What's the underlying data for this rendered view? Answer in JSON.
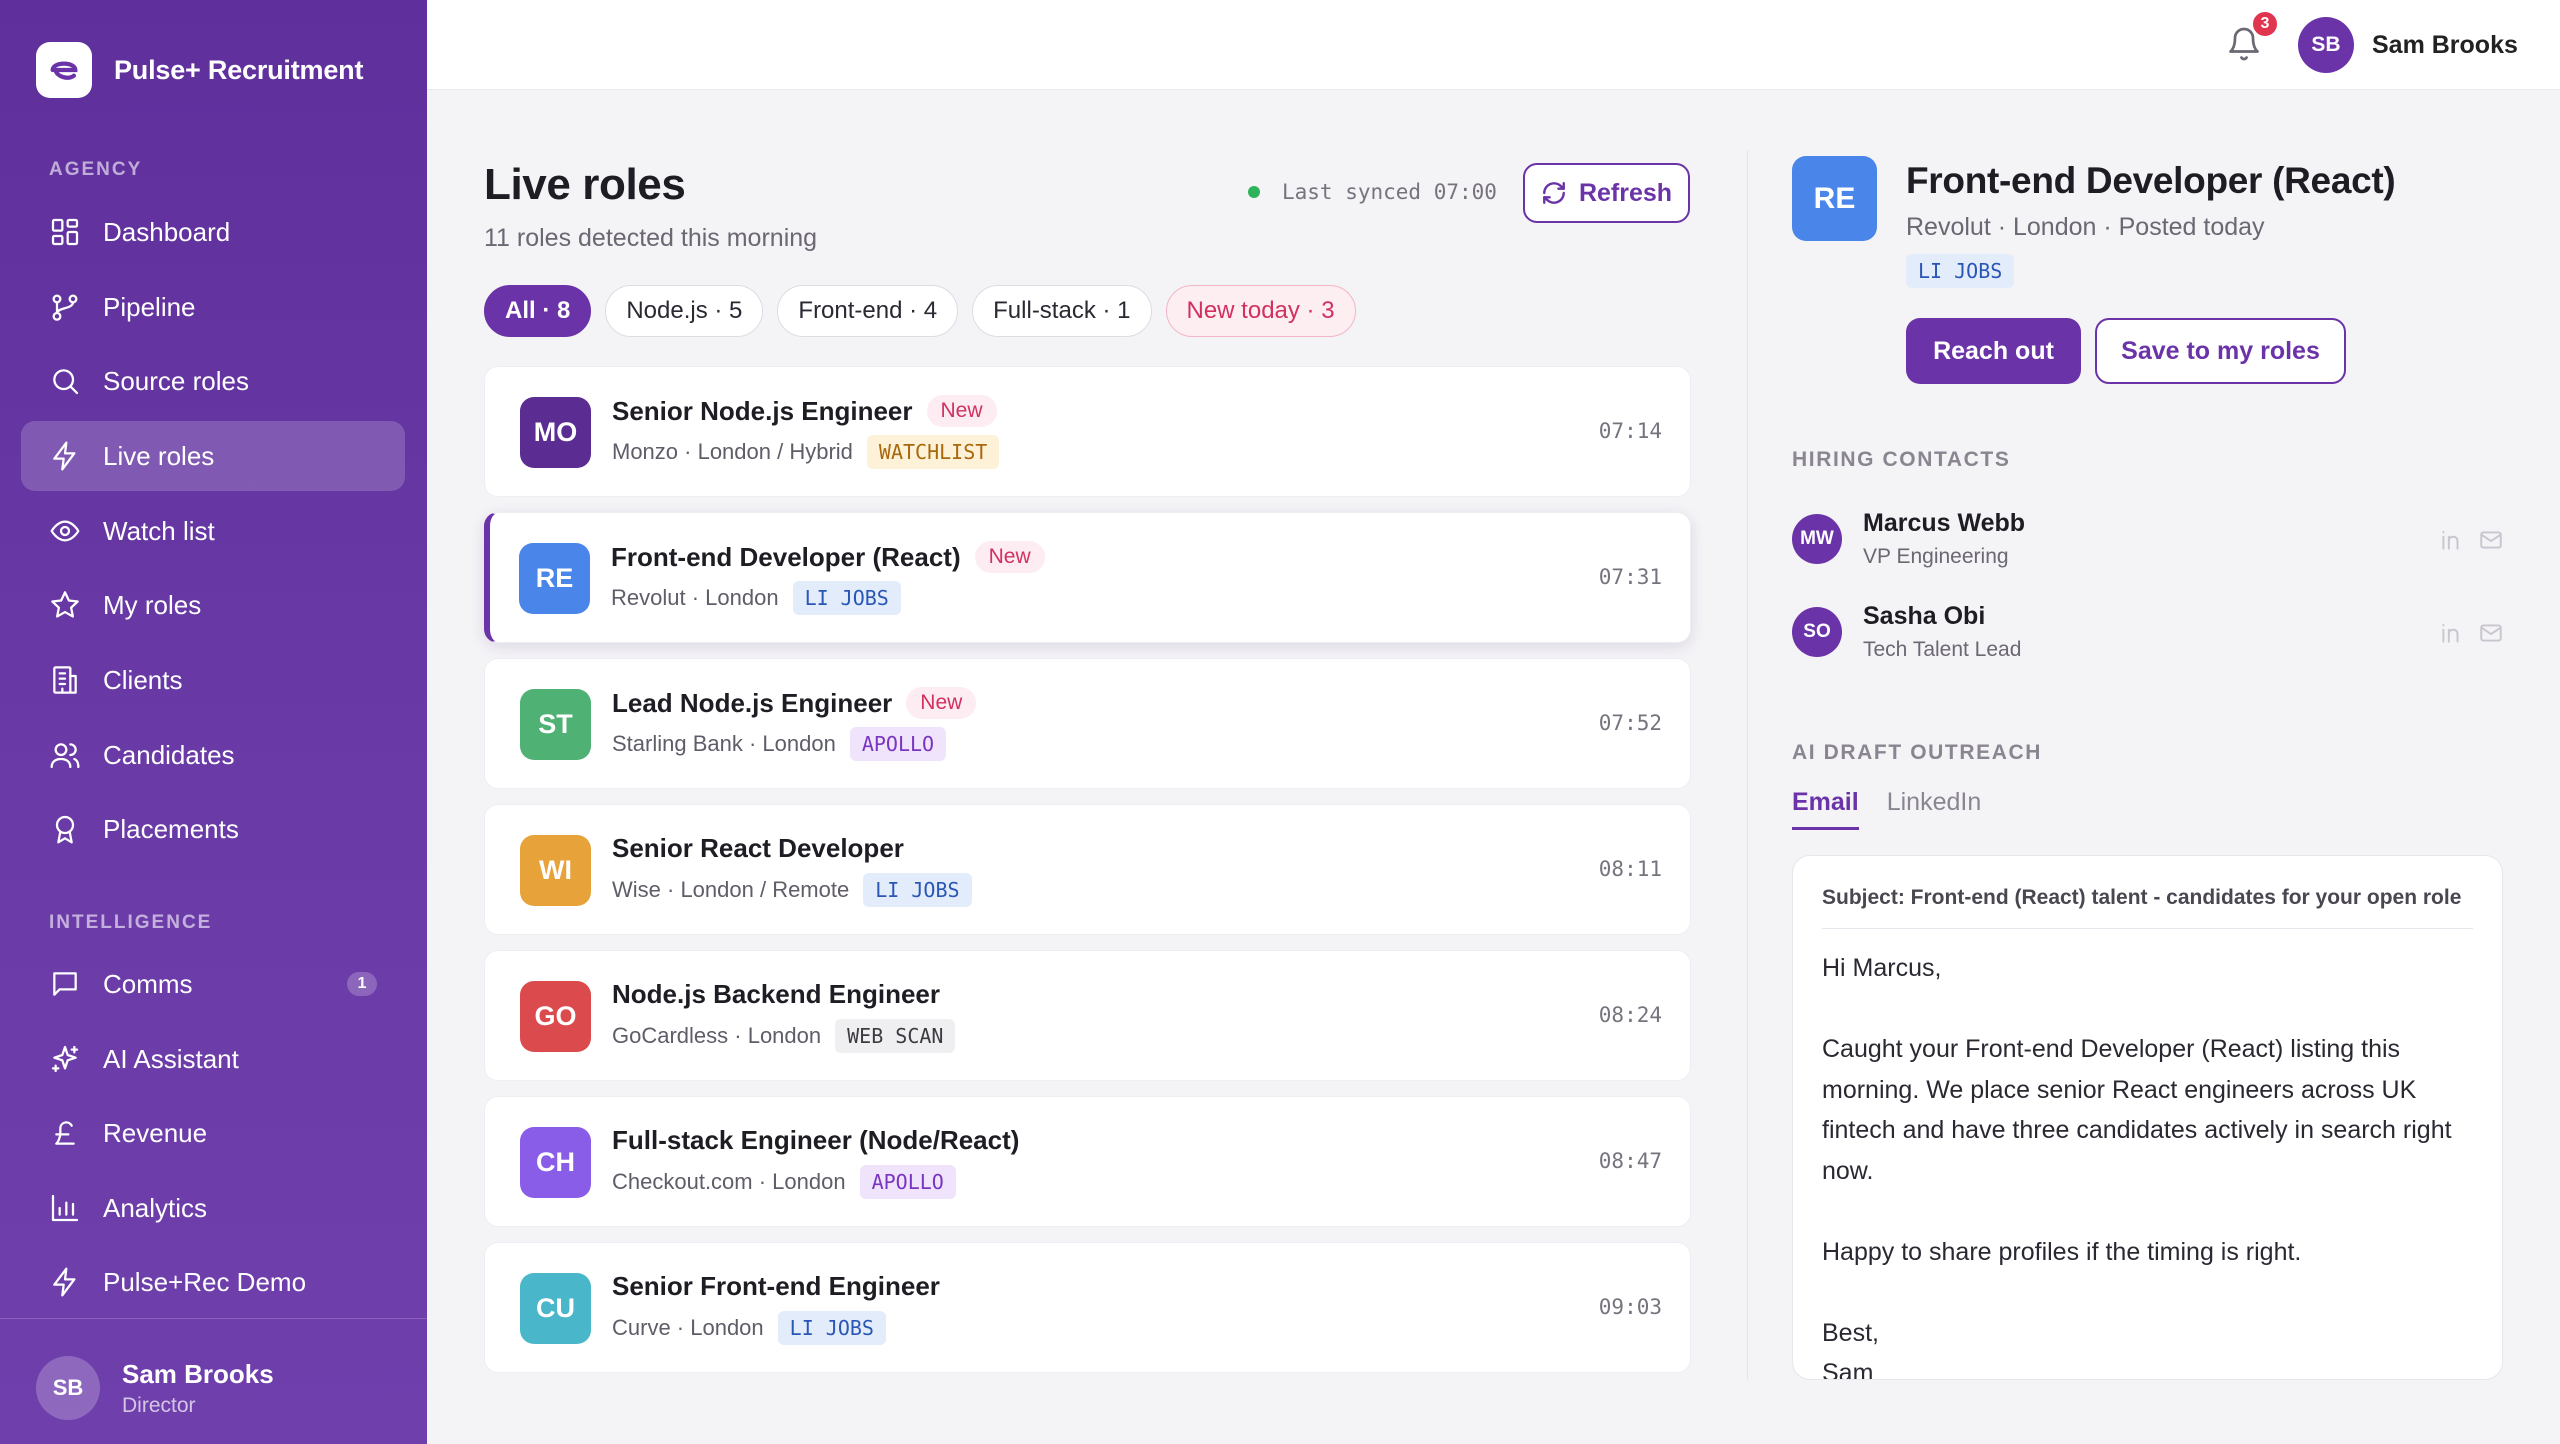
{
  "app": {
    "brand": "Pulse+ Recruitment"
  },
  "sidebar": {
    "sections": {
      "agency": "AGENCY",
      "intelligence": "INTELLIGENCE"
    },
    "items": [
      {
        "label": "Dashboard",
        "icon": "dashboard-icon"
      },
      {
        "label": "Pipeline",
        "icon": "pipeline-icon"
      },
      {
        "label": "Source roles",
        "icon": "search-icon"
      },
      {
        "label": "Live roles",
        "icon": "lightning-icon",
        "active": true
      },
      {
        "label": "Watch list",
        "icon": "eye-icon"
      },
      {
        "label": "My roles",
        "icon": "star-icon"
      },
      {
        "label": "Clients",
        "icon": "building-icon"
      },
      {
        "label": "Candidates",
        "icon": "users-icon"
      },
      {
        "label": "Placements",
        "icon": "award-icon"
      },
      {
        "label": "Comms",
        "icon": "message-icon",
        "badge": "1"
      },
      {
        "label": "AI Assistant",
        "icon": "sparkle-icon"
      },
      {
        "label": "Revenue",
        "icon": "pound-icon"
      },
      {
        "label": "Analytics",
        "icon": "bar-chart-icon"
      },
      {
        "label": "Pulse+Rec Demo",
        "icon": "lightning-icon"
      }
    ],
    "user": {
      "initials": "SB",
      "name": "Sam Brooks",
      "role": "Director"
    }
  },
  "topbar": {
    "notifications": "3",
    "user_initials": "SB",
    "user_name": "Sam Brooks"
  },
  "main": {
    "title": "Live roles",
    "subtitle": "11 roles detected this morning",
    "sync_text": "Last synced 07:00",
    "refresh_label": "Refresh",
    "filters": [
      {
        "label": "All · 8",
        "state": "active"
      },
      {
        "label": "Node.js · 5",
        "state": ""
      },
      {
        "label": "Front-end · 4",
        "state": ""
      },
      {
        "label": "Full-stack · 1",
        "state": ""
      },
      {
        "label": "New today · 3",
        "state": "hot"
      }
    ],
    "roles": [
      {
        "initials": "MO",
        "color": "#5b2d93",
        "title": "Senior Node.js Engineer",
        "new": "New",
        "meta": "Monzo · London / Hybrid",
        "source": "WATCHLIST",
        "source_class": "src-watch",
        "time": "07:14"
      },
      {
        "initials": "RE",
        "color": "#4a86ea",
        "title": "Front-end Developer (React)",
        "new": "New",
        "meta": "Revolut · London",
        "source": "LI JOBS",
        "source_class": "src-li",
        "time": "07:31",
        "selected": true
      },
      {
        "initials": "ST",
        "color": "#4fb174",
        "title": "Lead Node.js Engineer",
        "new": "New",
        "meta": "Starling Bank · London",
        "source": "APOLLO",
        "source_class": "src-apollo",
        "time": "07:52"
      },
      {
        "initials": "WI",
        "color": "#e7a23a",
        "title": "Senior React Developer",
        "new": "",
        "meta": "Wise · London / Remote",
        "source": "LI JOBS",
        "source_class": "src-li",
        "time": "08:11"
      },
      {
        "initials": "GO",
        "color": "#db4a4c",
        "title": "Node.js Backend Engineer",
        "new": "",
        "meta": "GoCardless · London",
        "source": "WEB SCAN",
        "source_class": "src-web",
        "time": "08:24"
      },
      {
        "initials": "CH",
        "color": "#8a5de8",
        "title": "Full-stack Engineer (Node/React)",
        "new": "",
        "meta": "Checkout.com · London",
        "source": "APOLLO",
        "source_class": "src-apollo",
        "time": "08:47"
      },
      {
        "initials": "CU",
        "color": "#4ab6c9",
        "title": "Senior Front-end Engineer",
        "new": "",
        "meta": "Curve · London",
        "source": "LI JOBS",
        "source_class": "src-li",
        "time": "09:03"
      }
    ]
  },
  "detail": {
    "initials": "RE",
    "title": "Front-end Developer (React)",
    "meta": "Revolut · London · Posted today",
    "source": "LI JOBS",
    "reach_label": "Reach out",
    "save_label": "Save to my roles",
    "contacts_heading": "HIRING CONTACTS",
    "contacts": [
      {
        "initials": "MW",
        "name": "Marcus Webb",
        "role": "VP Engineering"
      },
      {
        "initials": "SO",
        "name": "Sasha Obi",
        "role": "Tech Talent Lead"
      }
    ],
    "outreach_heading": "AI DRAFT OUTREACH",
    "tabs": [
      "Email",
      "LinkedIn"
    ],
    "draft": {
      "subject": "Subject: Front-end (React) talent - candidates for your open role",
      "greeting": "Hi Marcus,",
      "p1": "Caught your Front-end Developer (React) listing this morning. We place senior React engineers across UK fintech and have three candidates actively in search right now.",
      "p2": "Happy to share profiles if the timing is right.",
      "signoff": "Best,",
      "name": "Sam"
    }
  }
}
